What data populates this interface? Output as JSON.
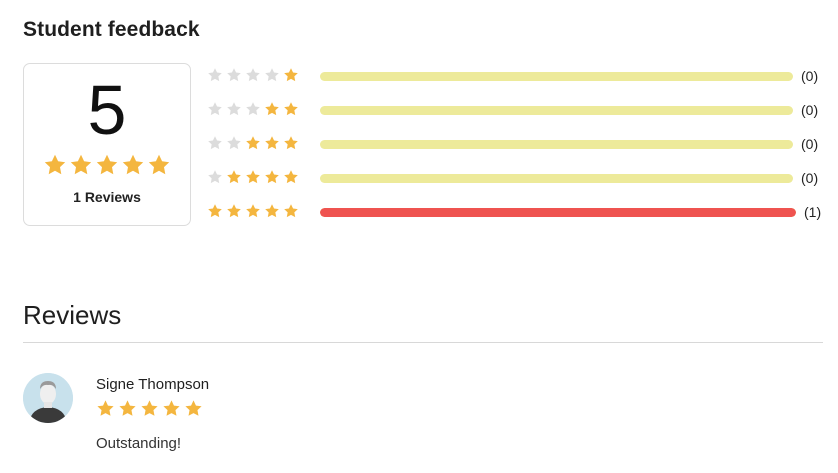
{
  "feedback": {
    "title": "Student feedback",
    "average": "5",
    "average_stars": 5,
    "reviews_label": "1 Reviews",
    "breakdown": [
      {
        "stars": 1,
        "count_label": "(0)",
        "fraction": 0
      },
      {
        "stars": 2,
        "count_label": "(0)",
        "fraction": 0
      },
      {
        "stars": 3,
        "count_label": "(0)",
        "fraction": 0
      },
      {
        "stars": 4,
        "count_label": "(0)",
        "fraction": 0
      },
      {
        "stars": 5,
        "count_label": "(1)",
        "fraction": 1
      }
    ]
  },
  "reviews": {
    "title": "Reviews",
    "items": [
      {
        "name": "Signe Thompson",
        "stars": 5,
        "text": "Outstanding!",
        "avatar_icon": "user-avatar-icon"
      }
    ]
  },
  "colors": {
    "star_on": "#f4b63f",
    "star_off": "#dcdcdc",
    "bar_track": "#edea9a",
    "bar_fill": "#ef5350"
  }
}
